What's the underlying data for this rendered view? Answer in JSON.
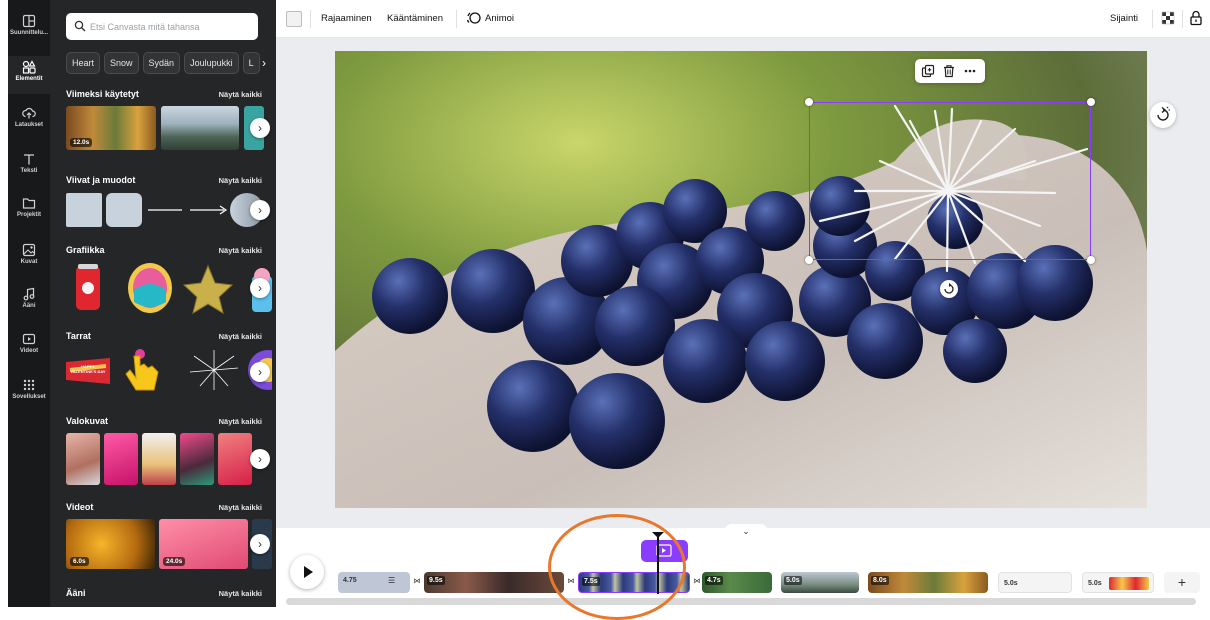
{
  "rail": {
    "items": [
      {
        "label": "Suunnittelu...",
        "icon": "layout-icon"
      },
      {
        "label": "Elementit",
        "icon": "elements-icon"
      },
      {
        "label": "Lataukset",
        "icon": "upload-cloud-icon"
      },
      {
        "label": "Teksti",
        "icon": "text-icon"
      },
      {
        "label": "Projektit",
        "icon": "folder-icon"
      },
      {
        "label": "Kuvat",
        "icon": "image-icon"
      },
      {
        "label": "Ääni",
        "icon": "music-note-icon"
      },
      {
        "label": "Videot",
        "icon": "video-icon"
      },
      {
        "label": "Sovellukset",
        "icon": "apps-grid-icon"
      }
    ]
  },
  "panel": {
    "search_placeholder": "Etsi Canvasta mitä tahansa",
    "chips": [
      "Heart",
      "Snow",
      "Sydän",
      "Joulupukki",
      "L"
    ],
    "see_all": "Näytä kaikki",
    "sections": {
      "recent": "Viimeksi käytetyt",
      "lines": "Viivat ja muodot",
      "graphics": "Grafiikka",
      "stickers": "Tarrat",
      "photos": "Valokuvat",
      "videos": "Videot",
      "audio": "Ääni"
    },
    "recent_duration": "12.0s",
    "video_durations": [
      "6.0s",
      "24.0s"
    ],
    "sticker_text": "HAPPY VALENTINE'S DAY"
  },
  "toolbar": {
    "crop": "Rajaaminen",
    "flip": "Kääntäminen",
    "animate": "Animoi",
    "position": "Sijainti"
  },
  "timeline": {
    "clips": [
      {
        "duration": "4.75"
      },
      {
        "duration": "9.5s"
      },
      {
        "duration": "7.5s"
      },
      {
        "duration": "4.7s"
      },
      {
        "duration": "5.0s"
      },
      {
        "duration": "8.0s"
      },
      {
        "duration": "5.0s"
      },
      {
        "duration": "5.0s"
      }
    ],
    "add_label": "+"
  },
  "colors": {
    "accent": "#8b3dff",
    "highlight_ring": "#e8782d",
    "panel_bg": "#252627",
    "rail_bg": "#18191b"
  }
}
